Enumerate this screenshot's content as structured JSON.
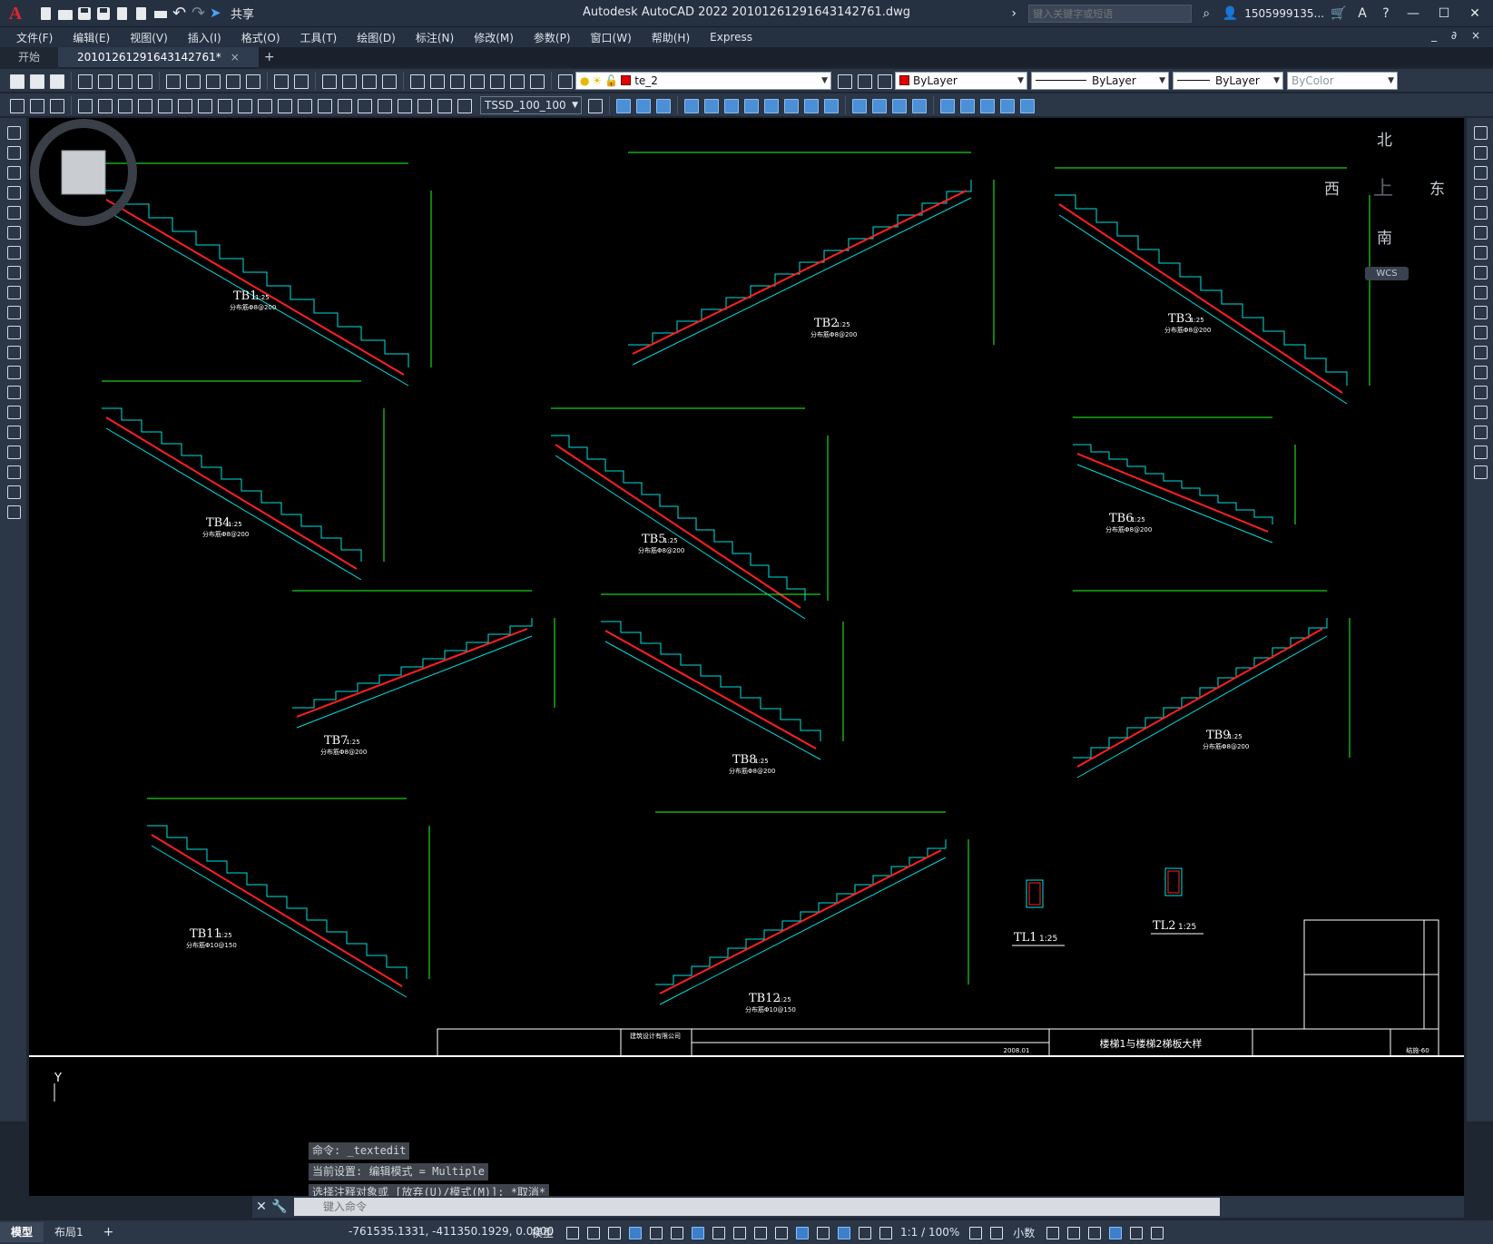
{
  "app": {
    "logo": "A",
    "window_title": "Autodesk AutoCAD 2022    20101261291643142761.dwg",
    "share_label": "共享",
    "search_placeholder": "键入关键字或短语",
    "user": "1505999135...",
    "menubar_right": "_ ∂ ×"
  },
  "menu": [
    "文件(F)",
    "编辑(E)",
    "视图(V)",
    "插入(I)",
    "格式(O)",
    "工具(T)",
    "绘图(D)",
    "标注(N)",
    "修改(M)",
    "参数(P)",
    "窗口(W)",
    "帮助(H)",
    "Express"
  ],
  "tabs": [
    {
      "label": "开始",
      "active": false
    },
    {
      "label": "20101261291643142761*",
      "active": true
    }
  ],
  "tab_close": "×",
  "tab_add": "+",
  "toolbar": {
    "layer_name": "te_2",
    "color": "ByLayer",
    "linetype": "ByLayer",
    "lineweight": "ByLayer",
    "plotstyle": "ByColor",
    "dimstyle": "TSSD_100_100"
  },
  "viewcube": {
    "north": "北",
    "south": "南",
    "east": "东",
    "west": "西",
    "top": "上",
    "wcs": "WCS"
  },
  "drawing": {
    "stairs": [
      {
        "label": "TB1",
        "scale": "1:25",
        "note": "分布筋Φ8@200"
      },
      {
        "label": "TB2",
        "scale": "1:25",
        "note": "分布筋Φ8@200"
      },
      {
        "label": "TB3",
        "scale": "1:25",
        "note": "分布筋Φ8@200"
      },
      {
        "label": "TB4",
        "scale": "1:25",
        "note": "分布筋Φ8@200"
      },
      {
        "label": "TB5",
        "scale": "1:25",
        "note": "分布筋Φ8@200"
      },
      {
        "label": "TB6",
        "scale": "1:25",
        "note": "分布筋Φ8@200"
      },
      {
        "label": "TB7",
        "scale": "1:25",
        "note": "分布筋Φ8@200"
      },
      {
        "label": "TB8",
        "scale": "1:25",
        "note": "分布筋Φ8@200"
      },
      {
        "label": "TB9",
        "scale": "1:25",
        "note": "分布筋Φ8@200"
      },
      {
        "label": "TB11",
        "scale": "1:25",
        "note": "分布筋Φ10@150"
      },
      {
        "label": "TB12",
        "scale": "1:25",
        "note": "分布筋Φ10@150"
      }
    ],
    "beams": [
      {
        "label": "TL1",
        "scale": "1:25"
      },
      {
        "label": "TL2",
        "scale": "1:25"
      }
    ],
    "title_block": {
      "drawing_name": "楼梯1与楼梯2梯板大样",
      "project": "建筑设计有限公司",
      "date": "2008.01",
      "sheet_no": "结施-60"
    },
    "axis_y": "Y"
  },
  "command": {
    "history": [
      "命令: _textedit",
      "当前设置: 编辑模式 = Multiple",
      "选择注释对象或 [放弃(U)/模式(M)]: *取消*"
    ],
    "placeholder": "键入命令"
  },
  "status": {
    "layouts": [
      {
        "label": "模型",
        "active": true
      },
      {
        "label": "布局1",
        "active": false
      }
    ],
    "add": "+",
    "coordinates": "-761535.1331, -411350.1929, 0.0000",
    "mode": "模型",
    "scale": "1:1 / 100%",
    "units": "小数"
  }
}
